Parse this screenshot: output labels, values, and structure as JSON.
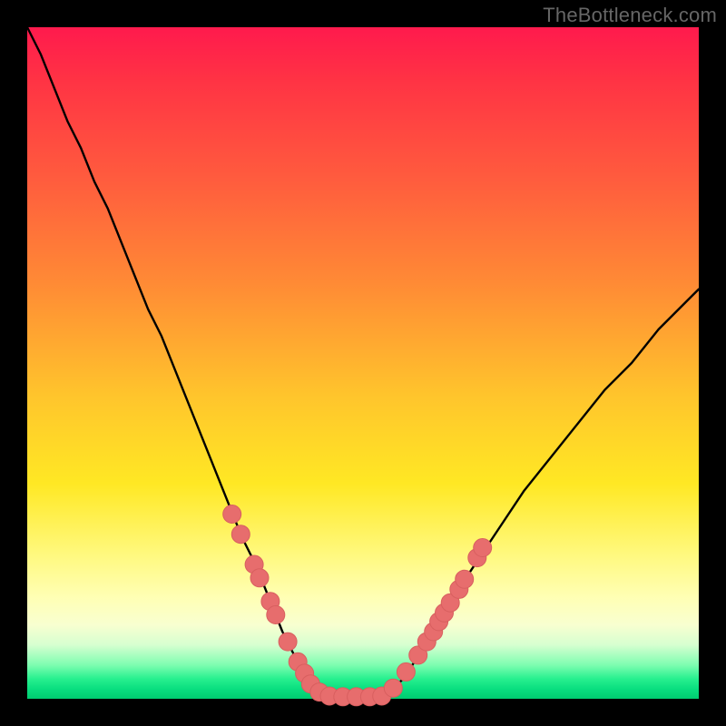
{
  "watermark": "TheBottleneck.com",
  "colors": {
    "frame": "#000000",
    "curve": "#000000",
    "marker_fill": "#e76d6d",
    "marker_stroke": "#d85f5f",
    "gradient_top": "#ff1a4d",
    "gradient_bottom": "#00cc70"
  },
  "chart_data": {
    "type": "line",
    "title": "",
    "xlabel": "",
    "ylabel": "",
    "xlim": [
      0,
      100
    ],
    "ylim": [
      0,
      100
    ],
    "note": "Axes have no visible tick labels. Values are read in percent of plot width (x) and percent of plot height measured from the bottom (y). The curve depicts bottleneck mismatch; the floor (~y=0) is the balanced zone; pink markers sit on the curve near the trough.",
    "series": [
      {
        "name": "bottleneck-curve",
        "x": [
          0,
          2,
          4,
          6,
          8,
          10,
          12,
          14,
          16,
          18,
          20,
          22,
          24,
          26,
          28,
          30,
          32,
          34,
          36,
          38,
          40,
          42,
          44,
          45,
          46,
          48,
          50,
          52,
          54,
          56,
          58,
          60,
          62,
          64,
          66,
          70,
          74,
          78,
          82,
          86,
          90,
          94,
          98,
          100
        ],
        "y": [
          100,
          96,
          91,
          86,
          82,
          77,
          73,
          68,
          63,
          58,
          54,
          49,
          44,
          39,
          34,
          29,
          24,
          20,
          15,
          10,
          6,
          3,
          1,
          0,
          0,
          0,
          0,
          0,
          1,
          3,
          6,
          9,
          12,
          16,
          19,
          25,
          31,
          36,
          41,
          46,
          50,
          55,
          59,
          61
        ]
      }
    ],
    "markers": {
      "name": "data-points",
      "points": [
        {
          "x": 30.5,
          "y": 27.5
        },
        {
          "x": 31.8,
          "y": 24.5
        },
        {
          "x": 33.8,
          "y": 20.0
        },
        {
          "x": 34.6,
          "y": 18.0
        },
        {
          "x": 36.2,
          "y": 14.5
        },
        {
          "x": 37.0,
          "y": 12.5
        },
        {
          "x": 38.8,
          "y": 8.5
        },
        {
          "x": 40.3,
          "y": 5.5
        },
        {
          "x": 41.3,
          "y": 3.8
        },
        {
          "x": 42.2,
          "y": 2.2
        },
        {
          "x": 43.5,
          "y": 1.0
        },
        {
          "x": 45.0,
          "y": 0.4
        },
        {
          "x": 47.0,
          "y": 0.3
        },
        {
          "x": 49.0,
          "y": 0.3
        },
        {
          "x": 51.0,
          "y": 0.3
        },
        {
          "x": 52.8,
          "y": 0.4
        },
        {
          "x": 54.5,
          "y": 1.6
        },
        {
          "x": 56.4,
          "y": 4.0
        },
        {
          "x": 58.2,
          "y": 6.5
        },
        {
          "x": 59.5,
          "y": 8.5
        },
        {
          "x": 60.5,
          "y": 10.0
        },
        {
          "x": 61.3,
          "y": 11.5
        },
        {
          "x": 62.1,
          "y": 12.8
        },
        {
          "x": 63.0,
          "y": 14.3
        },
        {
          "x": 64.3,
          "y": 16.3
        },
        {
          "x": 65.1,
          "y": 17.8
        },
        {
          "x": 67.0,
          "y": 21.0
        },
        {
          "x": 67.8,
          "y": 22.5
        }
      ]
    }
  }
}
